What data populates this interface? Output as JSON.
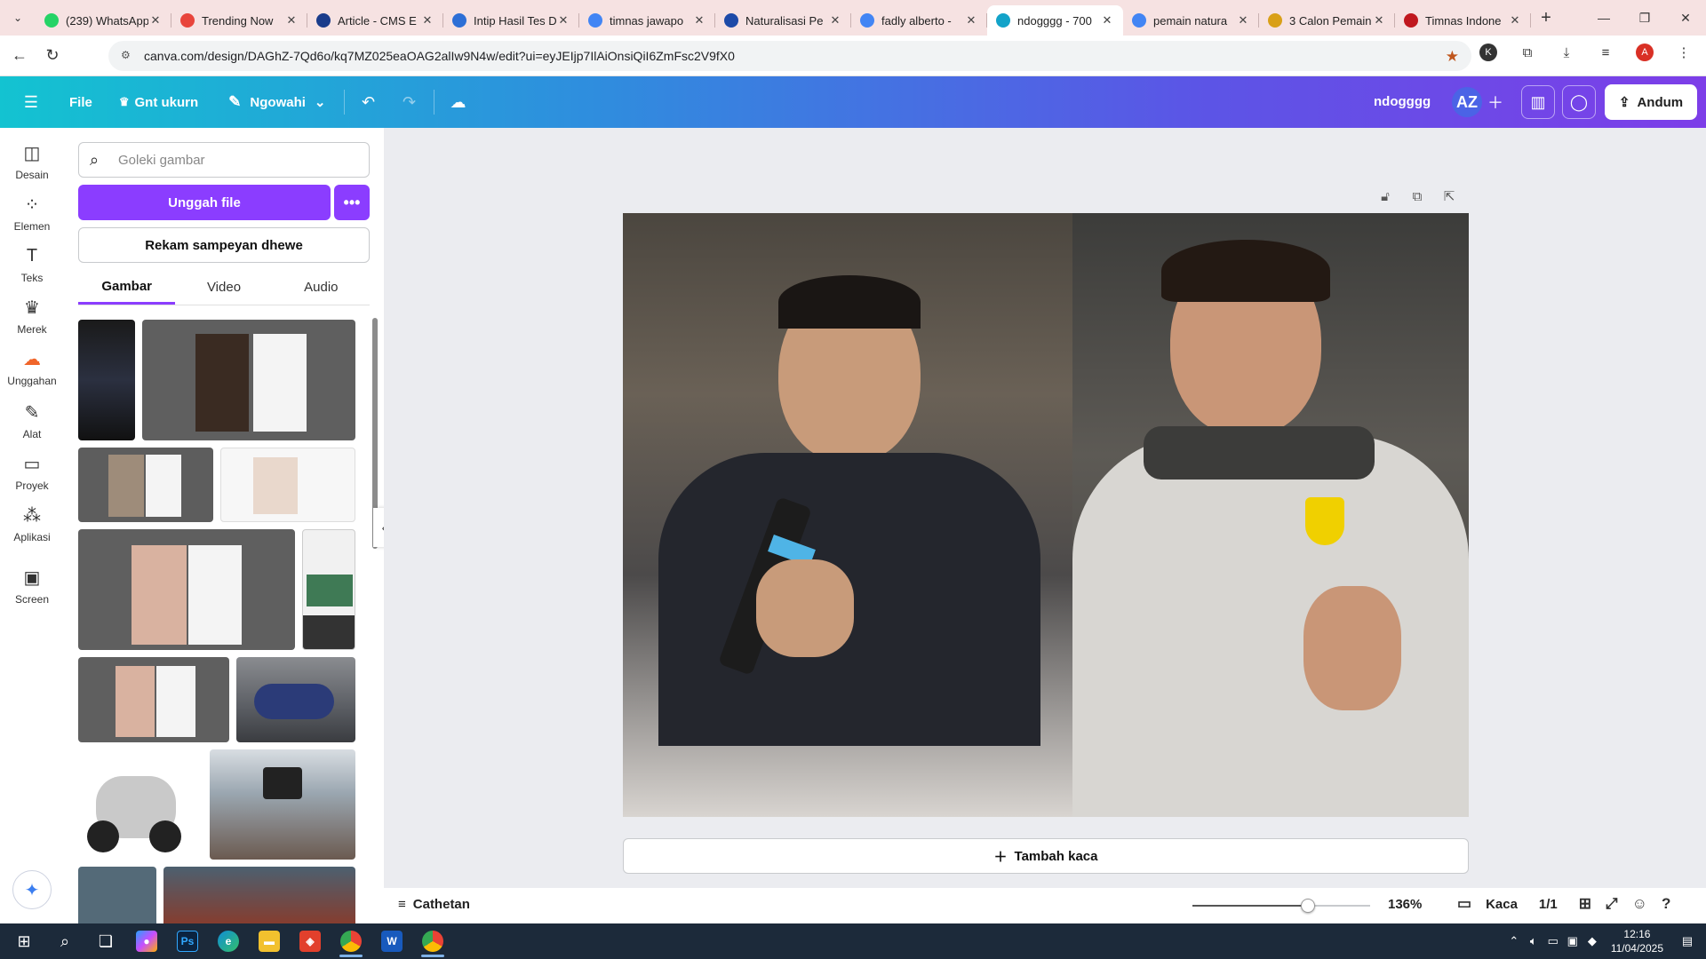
{
  "browser": {
    "tabs": [
      {
        "title": "(239) WhatsApp",
        "color": "#25d366"
      },
      {
        "title": "Trending Now",
        "color": "#e8453c"
      },
      {
        "title": "Article - CMS E",
        "color": "#1a3c8b"
      },
      {
        "title": "Intip Hasil Tes D",
        "color": "#2d6fd6"
      },
      {
        "title": "timnas jawapo",
        "color": "#4285f4"
      },
      {
        "title": "Naturalisasi Pe",
        "color": "#1d4aa8"
      },
      {
        "title": "fadly alberto -",
        "color": "#4285f4"
      },
      {
        "title": "ndogggg - 700",
        "color": "#13a3c9",
        "active": true
      },
      {
        "title": "pemain natura",
        "color": "#4285f4"
      },
      {
        "title": "3 Calon Pemain",
        "color": "#d9a018"
      },
      {
        "title": "Timnas Indone",
        "color": "#c0181f"
      }
    ],
    "url": "canva.com/design/DAGhZ-7Qd6o/kq7MZ025eaOAG2alIw9N4w/edit?ui=eyJEIjp7IlAiOnsiQiI6ZmFsc2V9fX0",
    "profile_initial": "A"
  },
  "canva": {
    "menu": {
      "file": "File",
      "resize": "Gnt ukurn",
      "edit": "Ngowahi"
    },
    "design_title": "ndogggg",
    "avatar_initials": "AZ",
    "share": "Andum",
    "rail": [
      {
        "label": "Desain",
        "icon": "template-icon"
      },
      {
        "label": "Elemen",
        "icon": "elements-icon"
      },
      {
        "label": "Teks",
        "icon": "text-icon"
      },
      {
        "label": "Merek",
        "icon": "brand-icon"
      },
      {
        "label": "Unggahan",
        "icon": "upload-icon"
      },
      {
        "label": "Alat",
        "icon": "draw-icon"
      },
      {
        "label": "Proyek",
        "icon": "folder-icon"
      },
      {
        "label": "Aplikasi",
        "icon": "apps-icon"
      },
      {
        "label": "Screen",
        "icon": "screen-icon"
      }
    ],
    "panel": {
      "search_placeholder": "Goleki gambar",
      "upload_label": "Unggah file",
      "record_label": "Rekam sampeyan dhewe",
      "tabs": [
        "Gambar",
        "Video",
        "Audio"
      ]
    },
    "add_page": "Tambah kaca",
    "notes": "Cathetan",
    "zoom": "136%",
    "zoom_fraction": 0.65,
    "pages_label": "Kaca",
    "page_count": "1/1"
  },
  "taskbar": {
    "time": "12:16",
    "date": "11/04/2025"
  },
  "colors": {
    "accent": "#8b3dff",
    "brand_gradient_start": "#13c3d1",
    "brand_gradient_end": "#7d3ee8"
  }
}
